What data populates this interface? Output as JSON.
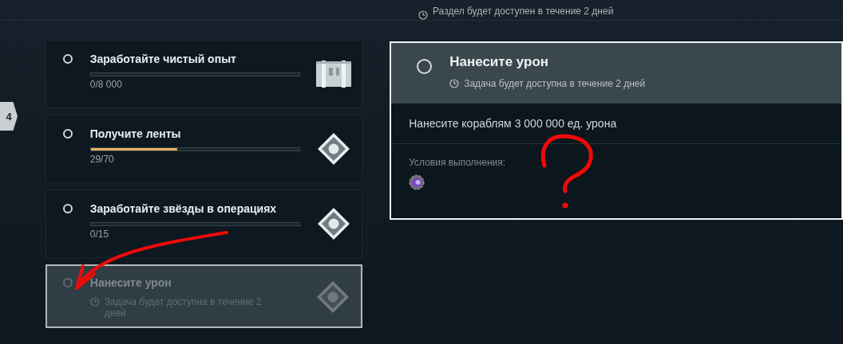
{
  "section_notice": {
    "text": "Раздел будет доступен в течение 2 дней"
  },
  "stage_badge": {
    "label": "4"
  },
  "tasks": [
    {
      "kind": "progress",
      "title": "Заработайте чистый опыт",
      "progress": "0/8 000",
      "level": 0,
      "reward": {
        "kind": "chest"
      },
      "selected": false,
      "disabled": false
    },
    {
      "kind": "progress",
      "title": "Получите ленты",
      "progress": "29/70",
      "level": 0.414,
      "reward": {
        "kind": "diamond"
      },
      "selected": false,
      "disabled": false
    },
    {
      "kind": "progress",
      "title": "Заработайте звёзды в операциях",
      "progress": "0/15",
      "level": 0,
      "reward": {
        "kind": "diamond"
      },
      "selected": false,
      "disabled": false
    },
    {
      "kind": "timed",
      "title": "Нанесите урон",
      "availability": "Задача будет доступна в течение 2 дней",
      "reward": {
        "kind": "diamond"
      },
      "selected": true,
      "disabled": true
    }
  ],
  "details": {
    "title": "Нанесите урон",
    "availability": "Задача будет доступна в течение 2 дней",
    "description": "Нанесите кораблям 3 000 000 ед. урона",
    "conditions_label": "Условия выполнения:",
    "condition_icons": [
      {
        "kind": "gear"
      }
    ]
  }
}
